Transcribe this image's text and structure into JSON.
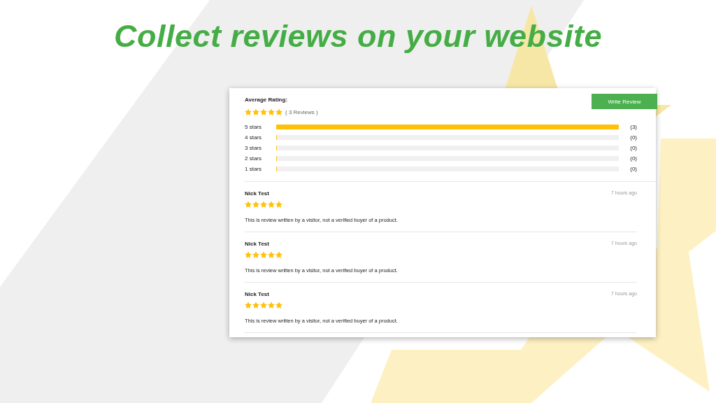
{
  "headline": "Collect reviews on your website",
  "summary": {
    "label": "Average Rating:",
    "stars": 5,
    "review_count": "( 3 Reviews )"
  },
  "write_review_button": "Write Review",
  "breakdown": [
    {
      "label": "5 stars",
      "level": 1,
      "count": "(3)"
    },
    {
      "label": "4 stars",
      "level": 0,
      "count": "(0)"
    },
    {
      "label": "3 stars",
      "level": 0,
      "count": "(0)"
    },
    {
      "label": "2 stars",
      "level": 0,
      "count": "(0)"
    },
    {
      "label": "1 stars",
      "level": 0,
      "count": "(0)"
    }
  ],
  "reviews": [
    {
      "author": "Nick Test",
      "stars": 5,
      "time": "7 hours ago",
      "text": "This is review written by a visitor, not a verified buyer of a product."
    },
    {
      "author": "Nick Test",
      "stars": 5,
      "time": "7 hours ago",
      "text": "This is review written by a visitor, not a verified buyer of a product."
    },
    {
      "author": "Nick Test",
      "stars": 5,
      "time": "7 hours ago",
      "text": "This is review written by a visitor, not a verified buyer of a product."
    }
  ]
}
